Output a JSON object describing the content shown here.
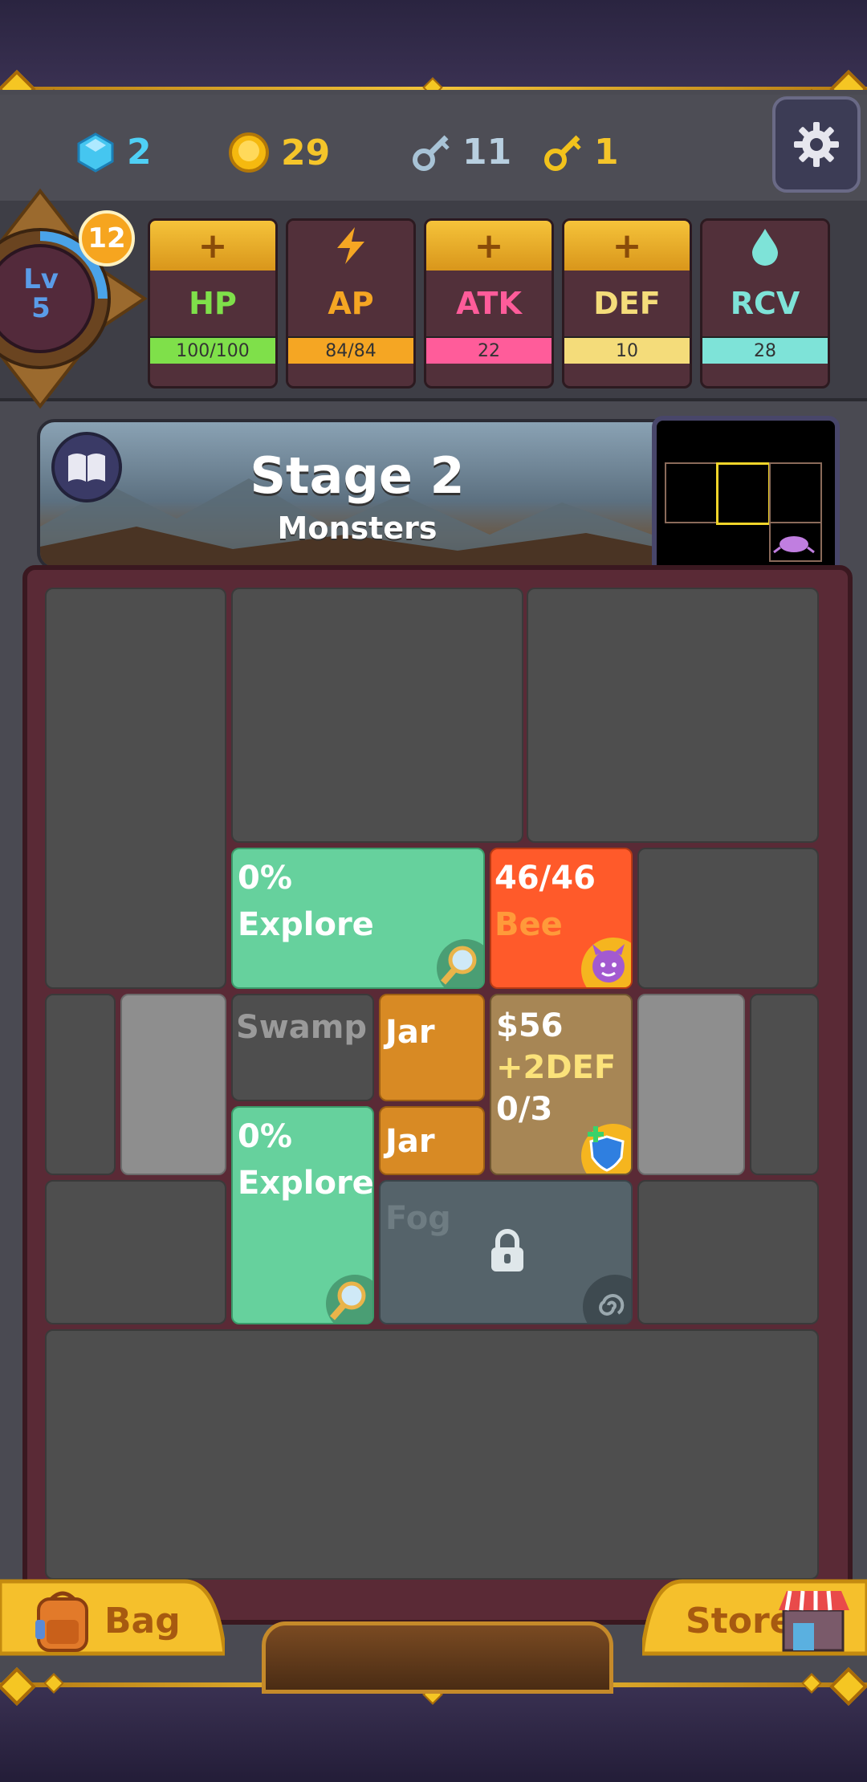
{
  "resources": {
    "gems": "2",
    "coins": "29",
    "silver_keys": "11",
    "gold_keys": "1"
  },
  "player": {
    "level_label": "Lv",
    "level": "5",
    "points": "12"
  },
  "stats": [
    {
      "name": "HP",
      "value": "100/100",
      "action": "+",
      "name_color": "#7fe04a",
      "bar_color": "#7fe04a"
    },
    {
      "name": "AP",
      "value": "84/84",
      "action": "lightning-icon",
      "name_color": "#f5a623",
      "bar_color": "#f5a623"
    },
    {
      "name": "ATK",
      "value": "22",
      "action": "+",
      "name_color": "#ff5c9a",
      "bar_color": "#ff5c9a"
    },
    {
      "name": "DEF",
      "value": "10",
      "action": "+",
      "name_color": "#f4dc7a",
      "bar_color": "#f4dc7a"
    },
    {
      "name": "RCV",
      "value": "28",
      "action": "drop-icon",
      "name_color": "#7ee3d8",
      "bar_color": "#7ee3d8"
    }
  ],
  "stage": {
    "title": "Stage 2",
    "subtitle": "Monsters"
  },
  "tiles": {
    "explore_1": {
      "percent": "0%",
      "label": "Explore"
    },
    "explore_2": {
      "percent": "0%",
      "label": "Explore"
    },
    "bee": {
      "hp": "46/46",
      "label": "Bee"
    },
    "swamp": {
      "label": "Swamp"
    },
    "jar_1": {
      "label": "Jar"
    },
    "jar_2": {
      "label": "Jar"
    },
    "shop": {
      "price": "$56",
      "effect": "+2DEF",
      "stock": "0/3"
    },
    "fog": {
      "label": "Fog"
    }
  },
  "bottom": {
    "bag_label": "Bag",
    "store_label": "Store"
  },
  "colors": {
    "explore": "#66d19d",
    "bee": "#ff5a2a",
    "jar": "#d88a24",
    "shop": "#a78655",
    "fog": "#55636a",
    "board_frame": "#5a2a36"
  }
}
